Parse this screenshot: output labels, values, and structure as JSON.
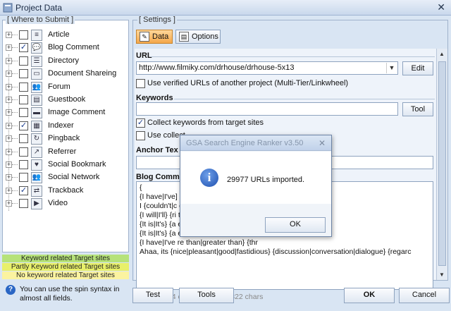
{
  "window": {
    "title": "Project Data",
    "close_glyph": "✕"
  },
  "where_to_submit": {
    "legend": "[ Where to Submit ]",
    "items": [
      {
        "label": "Article",
        "checked": false,
        "icon": "article-icon",
        "glyph": "≡"
      },
      {
        "label": "Blog Comment",
        "checked": true,
        "icon": "blog-comment-icon",
        "glyph": "💬"
      },
      {
        "label": "Directory",
        "checked": false,
        "icon": "directory-icon",
        "glyph": "☰"
      },
      {
        "label": "Document Shareing",
        "checked": false,
        "icon": "document-icon",
        "glyph": "▭"
      },
      {
        "label": "Forum",
        "checked": false,
        "icon": "forum-icon",
        "glyph": "👥"
      },
      {
        "label": "Guestbook",
        "checked": false,
        "icon": "guestbook-icon",
        "glyph": "▤"
      },
      {
        "label": "Image Comment",
        "checked": false,
        "icon": "image-comment-icon",
        "glyph": "▬"
      },
      {
        "label": "Indexer",
        "checked": true,
        "icon": "indexer-icon",
        "glyph": "▦"
      },
      {
        "label": "Pingback",
        "checked": false,
        "icon": "pingback-icon",
        "glyph": "↻"
      },
      {
        "label": "Referrer",
        "checked": false,
        "icon": "referrer-icon",
        "glyph": "↗"
      },
      {
        "label": "Social Bookmark",
        "checked": false,
        "icon": "social-bookmark-icon",
        "glyph": "♥"
      },
      {
        "label": "Social Network",
        "checked": false,
        "icon": "social-network-icon",
        "glyph": "👥"
      },
      {
        "label": "Trackback",
        "checked": true,
        "icon": "trackback-icon",
        "glyph": "⇄"
      },
      {
        "label": "Video",
        "checked": false,
        "icon": "video-icon",
        "glyph": "▶"
      }
    ],
    "legend_keyword": "Keyword related Target sites",
    "legend_partly": "Partly Keyword related Target sites",
    "legend_no": "No keyword related Target sites",
    "colors": {
      "keyword": "#b6e27a",
      "partly": "#e8f06a",
      "no": "#fbf3a0"
    }
  },
  "hint": {
    "text": "You can use the spin syntax in almost all fields.",
    "icon_glyph": "?"
  },
  "settings": {
    "legend": "[ Settings ]",
    "tab_data": "Data",
    "tab_options": "Options",
    "url_heading": "URL",
    "url_value": "http://www.filmiky.com/drhouse/drhouse-5x13",
    "edit_button": "Edit",
    "use_verified_urls": "Use verified URLs of another project (Multi-Tier/Linkwheel)",
    "keywords_heading": "Keywords",
    "keywords_value": "",
    "tool_button": "Tool",
    "collect_keywords": "Collect keywords from target sites",
    "collect_keywords_checked": true,
    "use_collect_partial": "Use collect",
    "anchor_heading": "Anchor Tex",
    "blog_heading": "Blog Comme",
    "blog_lines": [
      "{",
      "{I have|I've]                                                                    ree|3|2|4} hours today, y",
      "I {couldn't|c                                                              ery well|Perfectly|Well|Exc",
      "{I will|I'll} {ri                                                              th|grasp|seize|snatch} yo",
      "{It is|It's} {a                                                                e plans for the future and",
      "{It is|It's} {a                                                                ew|some} plans for {the f",
      "{I have|I've                                                                  re than|greater than} {thr",
      "Ahaa, its {nice|pleasant|good|fastidious} {discussion|conversation|dialogue} {regarc"
    ],
    "stats": "Shortest: 14 chars, Longest: 822 chars"
  },
  "bottom": {
    "test": "Test",
    "tools": "Tools",
    "ok": "OK",
    "cancel": "Cancel"
  },
  "dialog": {
    "title": "GSA Search Engine Ranker v3.50",
    "message": "29977 URLs imported.",
    "ok": "OK",
    "close_glyph": "✕",
    "info_glyph": "i"
  }
}
